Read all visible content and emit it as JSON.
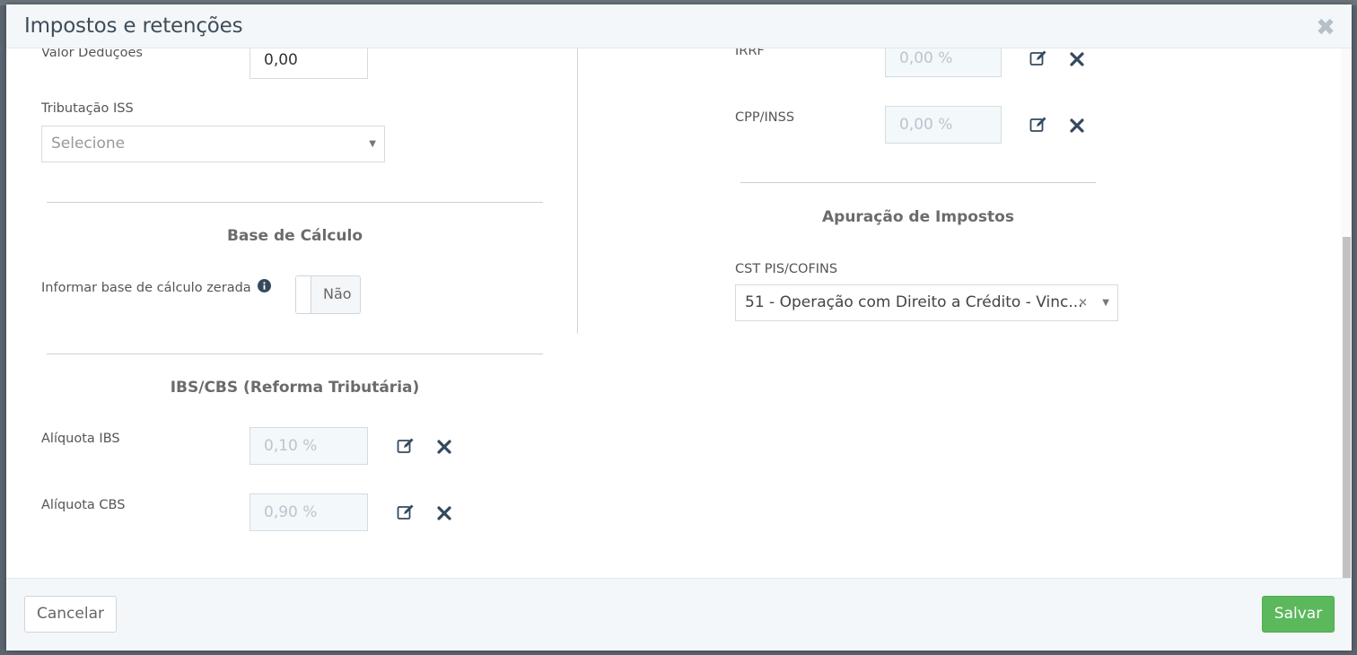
{
  "modal": {
    "title": "Impostos e retenções",
    "close_symbol": "✖"
  },
  "left": {
    "valor_deducoes": {
      "label": "Valor Deduções",
      "value": "0,00"
    },
    "tributacao_iss": {
      "label": "Tributação ISS",
      "placeholder": "Selecione"
    },
    "base_calculo": {
      "title": "Base de Cálculo",
      "zero_base_label": "Informar base de cálculo zerada",
      "toggle_value": "Não"
    },
    "ibs_cbs": {
      "title": "IBS/CBS (Reforma Tributária)",
      "ibs_label": "Alíquota IBS",
      "ibs_value": "0,10 %",
      "cbs_label": "Alíquota CBS",
      "cbs_value": "0,90 %"
    }
  },
  "right": {
    "irrf": {
      "label": "IRRF",
      "value": "0,00 %"
    },
    "cpp_inss": {
      "label": "CPP/INSS",
      "value": "0,00 %"
    },
    "apuracao": {
      "title": "Apuração de Impostos",
      "cst_label": "CST PIS/COFINS",
      "cst_value": "51 - Operação com Direito a Crédito - Vinc..."
    }
  },
  "footer": {
    "cancel_label": "Cancelar",
    "save_label": "Salvar"
  },
  "colors": {
    "save_button": "#5cb85c",
    "header_bg": "#f4f7f9",
    "title_text": "#3f4d59",
    "icon_dark": "#34495e"
  },
  "icons": {
    "edit": "edit-icon",
    "remove": "times-icon",
    "info": "info-circle-icon",
    "close": "close-icon",
    "caret": "caret-down-icon"
  }
}
